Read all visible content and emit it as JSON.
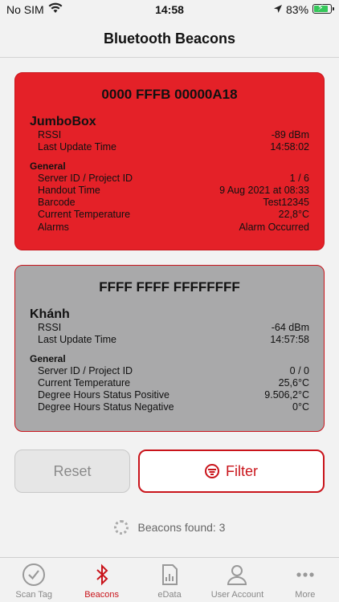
{
  "status_bar": {
    "carrier": "No SIM",
    "time": "14:58",
    "battery": "83%",
    "battery_level": 0.83
  },
  "nav": {
    "title": "Bluetooth Beacons"
  },
  "beacons": [
    {
      "id": "0000 FFFB 00000A18",
      "name": "JumboBox",
      "status_color": "#e42128",
      "rows": [
        {
          "label": "RSSI",
          "value": "-89 dBm"
        },
        {
          "label": "Last Update Time",
          "value": "14:58:02"
        }
      ],
      "section_title": "General",
      "general": [
        {
          "label": "Server ID / Project ID",
          "value": "1 / 6"
        },
        {
          "label": "Handout Time",
          "value": "9 Aug 2021 at 08:33"
        },
        {
          "label": "Barcode",
          "value": "Test12345"
        },
        {
          "label": "Current Temperature",
          "value": "22,8°C"
        },
        {
          "label": "Alarms",
          "value": "Alarm Occurred"
        }
      ]
    },
    {
      "id": "FFFF FFFF FFFFFFFF",
      "name": "Khánh",
      "status_color": "#a9a9aa",
      "rows": [
        {
          "label": "RSSI",
          "value": "-64 dBm"
        },
        {
          "label": "Last Update Time",
          "value": "14:57:58"
        }
      ],
      "section_title": "General",
      "general": [
        {
          "label": "Server ID / Project ID",
          "value": "0 / 0"
        },
        {
          "label": "Current Temperature",
          "value": "25,6°C"
        },
        {
          "label": "Degree Hours Status Positive",
          "value": "9.506,2°C"
        },
        {
          "label": "Degree Hours Status Negative",
          "value": "0°C"
        }
      ]
    }
  ],
  "buttons": {
    "reset": "Reset",
    "filter": "Filter"
  },
  "beacons_found": "Beacons found: 3",
  "tabs": [
    {
      "label": "Scan Tag",
      "icon": "checkmark-circle-icon"
    },
    {
      "label": "Beacons",
      "icon": "bluetooth-icon",
      "active": true
    },
    {
      "label": "eData",
      "icon": "document-chart-icon"
    },
    {
      "label": "User Account",
      "icon": "person-icon"
    },
    {
      "label": "More",
      "icon": "ellipsis-icon"
    }
  ],
  "colors": {
    "accent": "#c9141b",
    "alarm": "#e42128",
    "inactive": "#a9a9aa"
  }
}
